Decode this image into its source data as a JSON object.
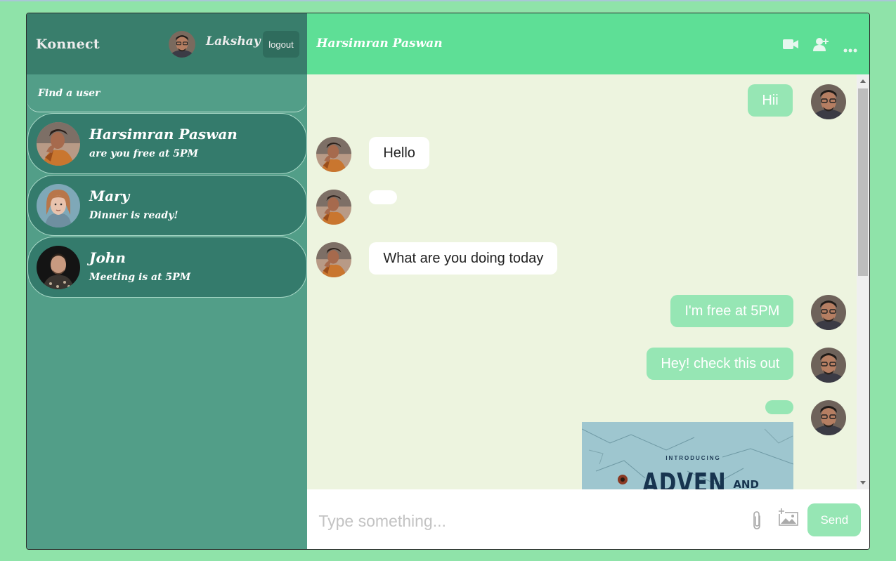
{
  "app": {
    "brand": "Konnect"
  },
  "user": {
    "name": "Lakshay",
    "logout_label": "logout"
  },
  "sidebar": {
    "search_placeholder": "Find a user",
    "contacts": [
      {
        "name": "Harsimran Paswan",
        "last": "are you free at 5PM",
        "avatar": "person-photo-man-cap"
      },
      {
        "name": "Mary",
        "last": "Dinner is ready!",
        "avatar": "person-photo-woman"
      },
      {
        "name": "John",
        "last": "Meeting is at 5PM",
        "avatar": "person-photo-man-dark"
      }
    ]
  },
  "chat": {
    "title": "Harsimran Paswan",
    "header_icons": [
      "video-camera-icon",
      "add-user-icon",
      "more-options-icon"
    ],
    "messages": [
      {
        "from": "me",
        "text": "Hii"
      },
      {
        "from": "them",
        "text": "Hello"
      },
      {
        "from": "them",
        "text": ""
      },
      {
        "from": "them",
        "text": "What are you doing today"
      },
      {
        "from": "me",
        "text": "I'm free at 5PM"
      },
      {
        "from": "me",
        "text": "Hey! check this out"
      },
      {
        "from": "me",
        "text": "",
        "image": {
          "line1": "INTRODUCING",
          "line2": "ADVEN",
          "line3": "AND"
        }
      }
    ]
  },
  "composer": {
    "placeholder": "Type something...",
    "send_label": "Send",
    "icons": [
      "paperclip-icon",
      "add-image-icon"
    ]
  },
  "colors": {
    "background": "#8fe3a9",
    "sidebar": "#529e88",
    "sidebar_header": "#397e6c",
    "contact": "#347b6c",
    "chat_header": "#5edf96",
    "chat_bg": "#edf4df",
    "outgoing_bubble": "#96e6b4"
  }
}
